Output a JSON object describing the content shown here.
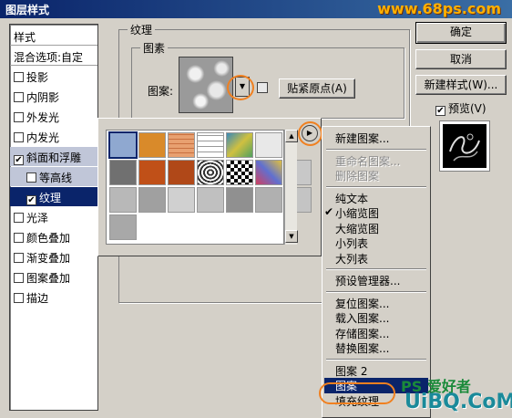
{
  "window": {
    "title": "图层样式",
    "watermark_top": "www.68ps.com"
  },
  "left_panel": {
    "items": [
      {
        "label": "样式",
        "checkbox": false,
        "checked": false,
        "kind": "header"
      },
      {
        "label": "混合选项:自定",
        "checkbox": false,
        "checked": false,
        "kind": "header"
      },
      {
        "label": "投影",
        "checkbox": true,
        "checked": false
      },
      {
        "label": "内阴影",
        "checkbox": true,
        "checked": false
      },
      {
        "label": "外发光",
        "checkbox": true,
        "checked": false
      },
      {
        "label": "内发光",
        "checkbox": true,
        "checked": false
      },
      {
        "label": "斜面和浮雕",
        "checkbox": true,
        "checked": true,
        "selected": "light"
      },
      {
        "label": "等高线",
        "checkbox": true,
        "checked": false,
        "indent": true,
        "selected": "light"
      },
      {
        "label": "纹理",
        "checkbox": true,
        "checked": true,
        "indent": true,
        "selected": "dark"
      },
      {
        "label": "光泽",
        "checkbox": true,
        "checked": false
      },
      {
        "label": "颜色叠加",
        "checkbox": true,
        "checked": false
      },
      {
        "label": "渐变叠加",
        "checkbox": true,
        "checked": false
      },
      {
        "label": "图案叠加",
        "checkbox": true,
        "checked": false
      },
      {
        "label": "描边",
        "checkbox": true,
        "checked": false
      }
    ]
  },
  "texture_group": {
    "title": "纹理",
    "sub_title": "图素",
    "pattern_label": "图案:",
    "snap_button": "贴紧原点(A)"
  },
  "right_buttons": {
    "ok": "确定",
    "cancel": "取消",
    "new_style": "新建样式(W)...",
    "preview_label": "预览(V)",
    "preview_checked": true
  },
  "menu": {
    "items": [
      {
        "label": "新建图案...",
        "type": "item"
      },
      {
        "type": "sep"
      },
      {
        "label": "重命名图案...",
        "type": "item",
        "disabled": true
      },
      {
        "label": "删除图案",
        "type": "item",
        "disabled": true
      },
      {
        "type": "sep"
      },
      {
        "label": "纯文本",
        "type": "item"
      },
      {
        "label": "小缩览图",
        "type": "item",
        "checked": true
      },
      {
        "label": "大缩览图",
        "type": "item"
      },
      {
        "label": "小列表",
        "type": "item"
      },
      {
        "label": "大列表",
        "type": "item"
      },
      {
        "type": "sep"
      },
      {
        "label": "预设管理器...",
        "type": "item"
      },
      {
        "type": "sep"
      },
      {
        "label": "复位图案...",
        "type": "item"
      },
      {
        "label": "载入图案...",
        "type": "item"
      },
      {
        "label": "存储图案...",
        "type": "item"
      },
      {
        "label": "替换图案...",
        "type": "item"
      },
      {
        "type": "sep"
      },
      {
        "label": "图案 2",
        "type": "item"
      },
      {
        "label": "图案",
        "type": "item",
        "highlighted": true
      },
      {
        "label": "填充纹理",
        "type": "item"
      }
    ]
  },
  "watermark_bottom": {
    "line1": "PS 爱好者",
    "line2": "UiBQ.CoM"
  },
  "swatch_colors": [
    [
      "#8fa8d0",
      "#d98a2a",
      "#e8a070",
      "#f4f4f4",
      "#4aa0c8",
      "#e8e8e8"
    ],
    [
      "#707070",
      "#c05018",
      "#b04818",
      "#e0e0e0",
      "#404040",
      "#b0a0c0",
      "#c8c8c8"
    ],
    [
      "#b8b8b8",
      "#a0a0a0",
      "#d0d0d0",
      "#c0c0c0",
      "#909090",
      "#b0b0b0",
      "#c4c4c4"
    ],
    [
      "#a8a8a8"
    ]
  ]
}
